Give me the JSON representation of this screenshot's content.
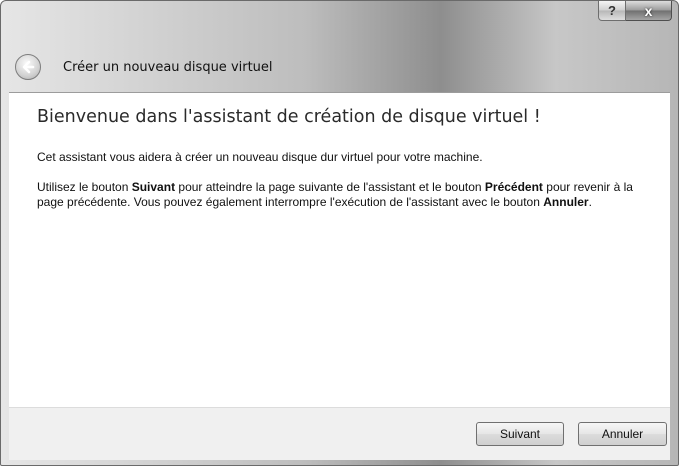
{
  "window": {
    "help_label": "?",
    "close_label": "x"
  },
  "header": {
    "title": "Créer un nouveau disque virtuel",
    "back_icon": "back-arrow-icon"
  },
  "content": {
    "heading": "Bienvenue dans l'assistant de création de disque virtuel !",
    "intro": "Cet assistant vous aidera à créer un nouveau disque dur virtuel pour votre machine.",
    "instructions": {
      "part1": "Utilisez le bouton ",
      "next_word": "Suivant",
      "part2": " pour atteindre la page suivante de l'assistant et le bouton ",
      "prev_word": "Précédent",
      "part3": " pour revenir à la page précédente. Vous pouvez également interrompre l'exécution de l'assistant avec le bouton ",
      "cancel_word": "Annuler",
      "part4": "."
    }
  },
  "footer": {
    "next_label": "Suivant",
    "cancel_label": "Annuler"
  }
}
